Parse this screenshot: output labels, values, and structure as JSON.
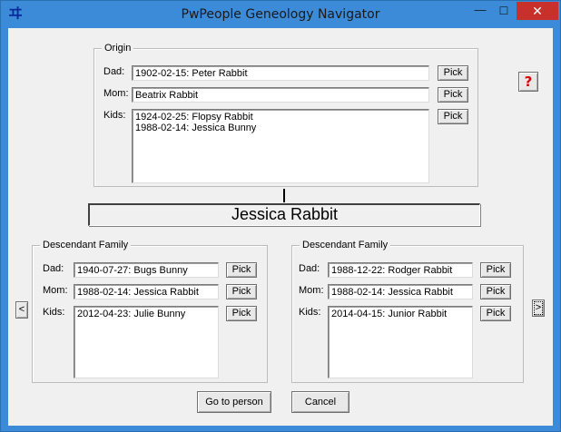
{
  "window": {
    "title": "PwPeople Geneology Navigator",
    "min_glyph": "—",
    "max_glyph": "☐",
    "close_glyph": "✕",
    "icon_glyph": "ヰ"
  },
  "help": {
    "label": "?"
  },
  "origin": {
    "legend": "Origin",
    "dad_label": "Dad:",
    "dad_value": "1902-02-15: Peter Rabbit",
    "mom_label": "Mom:",
    "mom_value": "Beatrix Rabbit",
    "kids_label": "Kids:",
    "kids": [
      "1924-02-25: Flopsy Rabbit",
      "1988-02-14: Jessica Bunny"
    ],
    "pick_label": "Pick"
  },
  "current_person": "Jessica Rabbit",
  "family_left": {
    "legend": "Descendant Family",
    "dad_label": "Dad:",
    "dad_value": "1940-07-27: Bugs Bunny",
    "mom_label": "Mom:",
    "mom_value": "1988-02-14: Jessica Rabbit",
    "kids_label": "Kids:",
    "kids": [
      "2012-04-23: Julie Bunny"
    ],
    "pick_label": "Pick"
  },
  "family_right": {
    "legend": "Descendant Family",
    "dad_label": "Dad:",
    "dad_value": "1988-12-22: Rodger Rabbit",
    "mom_label": "Mom:",
    "mom_value": "1988-02-14: Jessica Rabbit",
    "kids_label": "Kids:",
    "kids": [
      "2014-04-15: Junior Rabbit"
    ],
    "pick_label": "Pick"
  },
  "nav": {
    "prev_label": "<",
    "next_label": ">"
  },
  "actions": {
    "go_label": "Go to person",
    "cancel_label": "Cancel"
  }
}
